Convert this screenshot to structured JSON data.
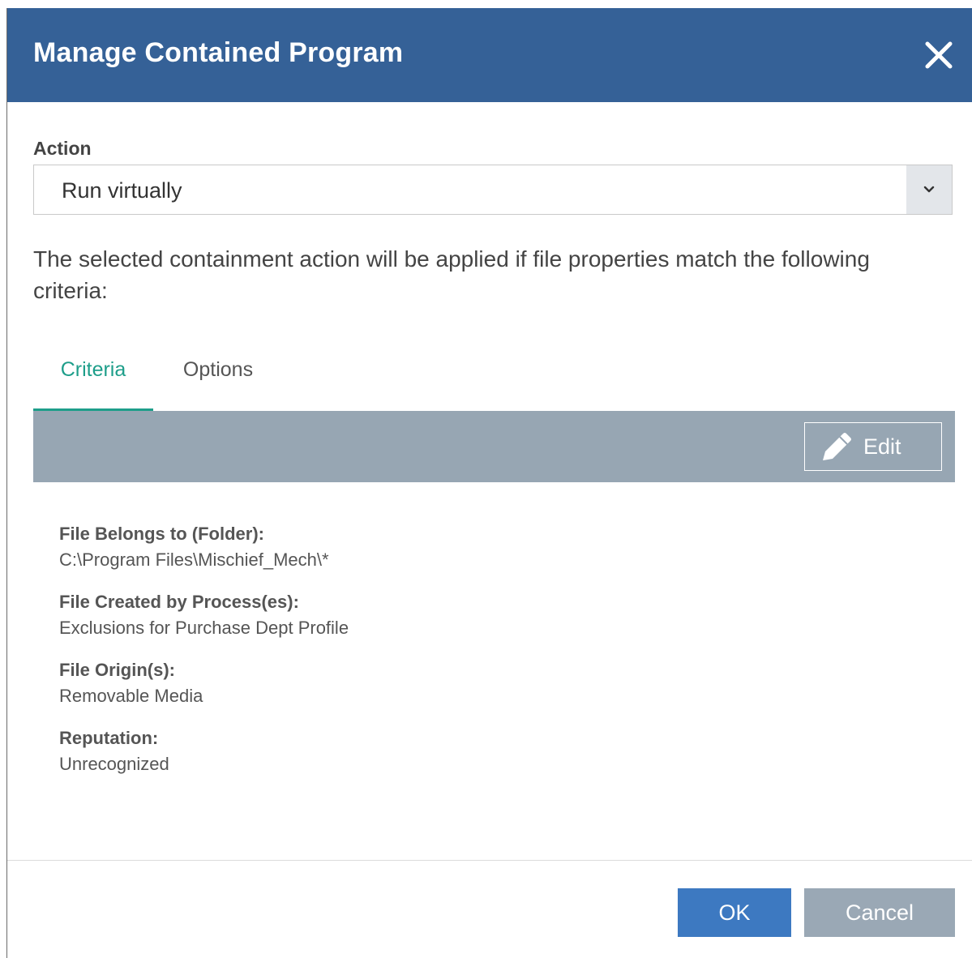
{
  "dialog": {
    "title": "Manage Contained Program",
    "close_icon": "close-icon"
  },
  "action": {
    "label": "Action",
    "selected": "Run virtually",
    "arrow_icon": "chevron-down-icon"
  },
  "description": "The selected containment action will be applied if file properties match the following criteria:",
  "tabs": [
    {
      "label": "Criteria",
      "active": true
    },
    {
      "label": "Options",
      "active": false
    }
  ],
  "toolbar": {
    "edit_label": "Edit",
    "edit_icon": "pencil-icon"
  },
  "criteria": [
    {
      "label": "File Belongs to (Folder):",
      "value": "C:\\Program Files\\Mischief_Mech\\*"
    },
    {
      "label": "File Created by Process(es):",
      "value": "Exclusions for Purchase Dept Profile"
    },
    {
      "label": "File Origin(s):",
      "value": "Removable Media"
    },
    {
      "label": "Reputation:",
      "value": "Unrecognized"
    }
  ],
  "footer": {
    "ok_label": "OK",
    "cancel_label": "Cancel"
  },
  "colors": {
    "titlebar": "#356197",
    "accent_tab": "#1e9e8a",
    "toolbar": "#97a6b3",
    "ok_button": "#3d79c1",
    "cancel_button": "#9aa8b5"
  }
}
